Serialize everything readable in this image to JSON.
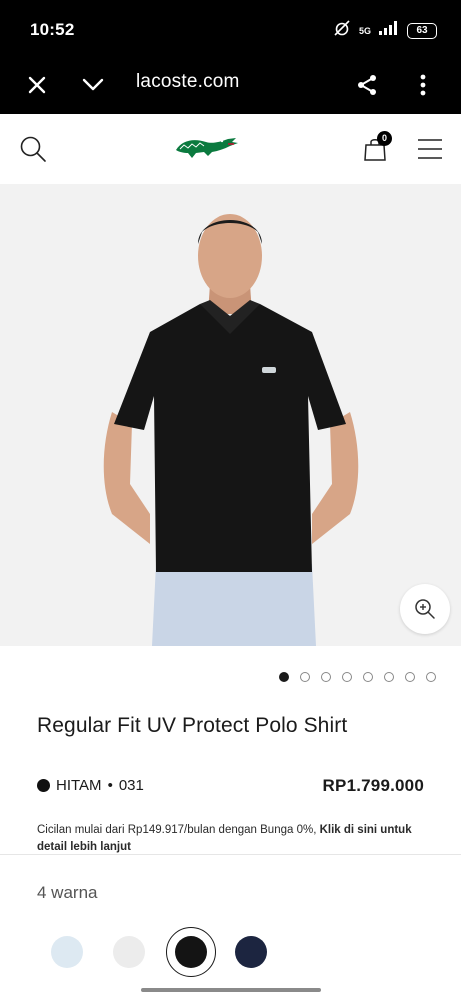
{
  "status_bar": {
    "time": "10:52",
    "network": "5G",
    "battery": "63"
  },
  "browser": {
    "url": "lacoste.com"
  },
  "header": {
    "cart_count": "0"
  },
  "product": {
    "title": "Regular Fit UV Protect Polo Shirt",
    "color_name": "HITAM",
    "color_code": "031",
    "price": "RP1.799.000",
    "installment_text": "Cicilan mulai dari Rp149.917/bulan dengan Bunga 0%,",
    "installment_link": "Klik di sini untuk detail lebih lanjut",
    "image_count": 8,
    "active_image": 1
  },
  "variants": {
    "count_label": "4 warna",
    "swatches": [
      {
        "color": "#dde9f2",
        "selected": false
      },
      {
        "color": "#ececec",
        "selected": false
      },
      {
        "color": "#141414",
        "selected": true
      },
      {
        "color": "#1c2540",
        "selected": false
      }
    ]
  },
  "colors": {
    "brand_green": "#0b7a3f",
    "dark": "#1b1b1b"
  }
}
